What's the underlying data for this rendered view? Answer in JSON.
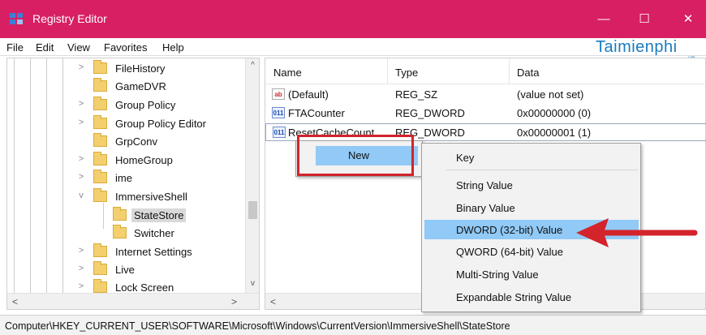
{
  "window": {
    "title": "Registry Editor"
  },
  "window_controls": {
    "minimize": "—",
    "maximize": "☐",
    "close": "✕"
  },
  "menu": [
    "File",
    "Edit",
    "View",
    "Favorites",
    "Help"
  ],
  "watermark": {
    "main": "Taimienphi",
    "sub": ".vn"
  },
  "tree": {
    "items": [
      {
        "label": "FileHistory",
        "expander": ">"
      },
      {
        "label": "GameDVR",
        "expander": ""
      },
      {
        "label": "Group Policy",
        "expander": ">"
      },
      {
        "label": "Group Policy Editor",
        "expander": ">"
      },
      {
        "label": "GrpConv",
        "expander": ""
      },
      {
        "label": "HomeGroup",
        "expander": ">"
      },
      {
        "label": "ime",
        "expander": ">"
      },
      {
        "label": "ImmersiveShell",
        "expander": "v"
      },
      {
        "label": "StateStore",
        "expander": "",
        "selected": true
      },
      {
        "label": "Switcher",
        "expander": ""
      },
      {
        "label": "Internet Settings",
        "expander": ">"
      },
      {
        "label": "Live",
        "expander": ">"
      },
      {
        "label": "Lock Screen",
        "expander": ">"
      }
    ],
    "scroll_up": "^",
    "scroll_down": "v",
    "scroll_left": "<",
    "scroll_right": ">"
  },
  "list": {
    "headers": {
      "name": "Name",
      "type": "Type",
      "data": "Data"
    },
    "rows": [
      {
        "icon": "string-value-icon",
        "glyph": "ab",
        "name": "(Default)",
        "type": "REG_SZ",
        "data": "(value not set)"
      },
      {
        "icon": "dword-value-icon",
        "glyph": "011",
        "name": "FTACounter",
        "type": "REG_DWORD",
        "data": "0x00000000 (0)"
      },
      {
        "icon": "dword-value-icon",
        "glyph": "011",
        "name": "ResetCacheCount",
        "type": "REG_DWORD",
        "data": "0x00000001 (1)"
      }
    ],
    "scroll_left": "<"
  },
  "context_menu": {
    "new_label": "New"
  },
  "submenu": {
    "items": [
      {
        "label": "Key"
      },
      {
        "label": "String Value"
      },
      {
        "label": "Binary Value"
      },
      {
        "label": "DWORD (32-bit) Value",
        "highlighted": true
      },
      {
        "label": "QWORD (64-bit) Value"
      },
      {
        "label": "Multi-String Value"
      },
      {
        "label": "Expandable String Value"
      }
    ]
  },
  "statusbar": {
    "path": "Computer\\HKEY_CURRENT_USER\\SOFTWARE\\Microsoft\\Windows\\CurrentVersion\\ImmersiveShell\\StateStore"
  },
  "colors": {
    "titlebar": "#d81f64",
    "annotation_red": "#d3232b",
    "highlight": "#91c9f7",
    "folder": "#f3cf6e"
  }
}
